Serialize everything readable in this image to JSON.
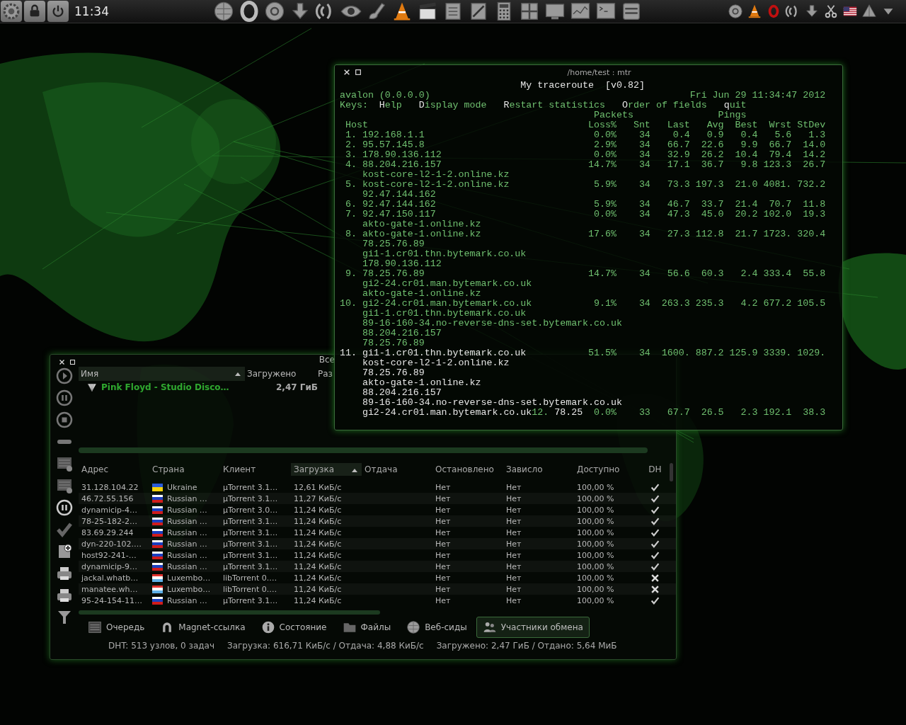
{
  "taskbar": {
    "clock": "11:34"
  },
  "terminal": {
    "title": "/home/test : mtr",
    "heading": "My traceroute  [v0.82]",
    "hostname": "avalon (0.0.0.0)",
    "datetime": "Fri Jun 29 11:34:47 2012",
    "keys_label": "Keys:",
    "keys": [
      "Help",
      "Display mode",
      "Restart statistics",
      "Order of fields",
      "quit"
    ],
    "groups": [
      "Packets",
      "Pings"
    ],
    "columns": [
      "Host",
      "Loss%",
      "Snt",
      "Last",
      "Avg",
      "Best",
      "Wrst",
      "StDev"
    ],
    "hops": [
      {
        "number": "1.",
        "host": "192.168.1.1",
        "stats": [
          "0.0%",
          "34",
          "0.4",
          "0.9",
          "0.4",
          "5.6",
          "1.3"
        ],
        "bright": false,
        "number_bright": false
      },
      {
        "number": "2.",
        "host": "95.57.145.8",
        "stats": [
          "2.9%",
          "34",
          "66.7",
          "22.6",
          "9.9",
          "66.7",
          "14.0"
        ],
        "bright": false,
        "number_bright": false
      },
      {
        "number": "3.",
        "host": "178.90.136.112",
        "stats": [
          "0.0%",
          "34",
          "32.9",
          "26.2",
          "10.4",
          "79.4",
          "14.2"
        ],
        "bright": false,
        "number_bright": false
      },
      {
        "number": "4.",
        "host": "88.204.216.157",
        "stats": [
          "14.7%",
          "34",
          "17.1",
          "36.7",
          "9.8",
          "123.3",
          "26.7"
        ],
        "bright": false,
        "number_bright": false,
        "extras": [
          "kost-core-l2-1-2.online.kz"
        ]
      },
      {
        "number": "5.",
        "host": "kost-core-l2-1-2.online.kz",
        "stats": [
          "5.9%",
          "34",
          "73.3",
          "197.3",
          "21.0",
          "4081.",
          "732.2"
        ],
        "bright": false,
        "number_bright": false,
        "extras": [
          "92.47.144.162"
        ]
      },
      {
        "number": "6.",
        "host": "92.47.144.162",
        "stats": [
          "5.9%",
          "34",
          "46.7",
          "33.7",
          "21.4",
          "70.7",
          "11.8"
        ],
        "bright": false,
        "number_bright": false
      },
      {
        "number": "7.",
        "host": "92.47.150.117",
        "stats": [
          "0.0%",
          "34",
          "47.3",
          "45.0",
          "20.2",
          "102.0",
          "19.3"
        ],
        "bright": false,
        "number_bright": false,
        "extras": [
          "akto-gate-1.online.kz"
        ]
      },
      {
        "number": "8.",
        "host": "akto-gate-1.online.kz",
        "stats": [
          "17.6%",
          "34",
          "27.3",
          "112.8",
          "21.7",
          "1723.",
          "320.4"
        ],
        "bright": false,
        "number_bright": false,
        "extras": [
          "78.25.76.89",
          "gi1-1.cr01.thn.bytemark.co.uk",
          "178.90.136.112"
        ]
      },
      {
        "number": "9.",
        "host": "78.25.76.89",
        "stats": [
          "14.7%",
          "34",
          "56.6",
          "60.3",
          "2.4",
          "333.4",
          "55.8"
        ],
        "bright": false,
        "number_bright": false,
        "extras": [
          "gi2-24.cr01.man.bytemark.co.uk",
          "akto-gate-1.online.kz"
        ]
      },
      {
        "number": "10.",
        "host": "gi2-24.cr01.man.bytemark.co.uk",
        "stats": [
          "9.1%",
          "34",
          "263.3",
          "235.3",
          "4.2",
          "677.2",
          "105.5"
        ],
        "bright": false,
        "number_bright": false,
        "extras": [
          "gi1-1.cr01.thn.bytemark.co.uk",
          "89-16-160-34.no-reverse-dns-set.bytemark.co.uk",
          "88.204.216.157",
          "78.25.76.89"
        ]
      },
      {
        "number": "11.",
        "host": "gi1-1.cr01.thn.bytemark.co.uk",
        "stats": [
          "51.5%",
          "34",
          "1600.",
          "887.2",
          "125.9",
          "3339.",
          "1029."
        ],
        "bright": true,
        "number_bright": true,
        "extras": [
          "kost-core-l2-1-2.online.kz",
          "78.25.76.89",
          "akto-gate-1.online.kz",
          "88.204.216.157",
          "89-16-160-34.no-reverse-dns-set.bytemark.co.uk",
          "gi2-24.cr01.man.bytemark.co.uk"
        ]
      },
      {
        "number": "12.",
        "host": "78.25",
        "stats": [
          "0.0%",
          "33",
          "67.7",
          "26.5",
          "2.3",
          "192.1",
          "38.3"
        ],
        "bright": true,
        "number_bright": false,
        "joined": true
      }
    ]
  },
  "torrent": {
    "title": "Все",
    "list_columns": [
      {
        "label": "Имя",
        "sorted": true
      },
      {
        "label": "Загружено",
        "sorted": false
      },
      {
        "label": "Раз",
        "sorted": false
      }
    ],
    "torrents": [
      {
        "name": "Pink Floyd - Studio Disco…",
        "downloaded": "2,47 ГиБ"
      }
    ],
    "peer_columns": [
      {
        "label": "Адрес",
        "sorted": false
      },
      {
        "label": "Страна",
        "sorted": false
      },
      {
        "label": "Клиент",
        "sorted": false
      },
      {
        "label": "Загрузка",
        "sorted": true
      },
      {
        "label": "Отдача",
        "sorted": false
      },
      {
        "label": "Остановлено",
        "sorted": false
      },
      {
        "label": "Зависло",
        "sorted": false
      },
      {
        "label": "Доступно",
        "sorted": false
      },
      {
        "label": "DH",
        "sorted": false
      }
    ],
    "peers": [
      {
        "address": "31.128.104.22",
        "kind": "ukraine",
        "country": "Ukraine",
        "client": "µTorrent 3.1…",
        "download": "12,61 КиБ/с",
        "stopped": "Нет",
        "stalled": "Нет",
        "available": "100,00 %",
        "checked": true
      },
      {
        "address": "46.72.55.156",
        "kind": "russia",
        "country": "Russian …",
        "client": "µTorrent 3.1…",
        "download": "11,27 КиБ/с",
        "stopped": "Нет",
        "stalled": "Нет",
        "available": "100,00 %",
        "checked": true
      },
      {
        "address": "dynamicip-4…",
        "kind": "russia",
        "country": "Russian …",
        "client": "µTorrent 3.0…",
        "download": "11,24 КиБ/с",
        "stopped": "Нет",
        "stalled": "Нет",
        "available": "100,00 %",
        "checked": true
      },
      {
        "address": "78-25-182-2…",
        "kind": "russia",
        "country": "Russian …",
        "client": "µTorrent 3.1…",
        "download": "11,24 КиБ/с",
        "stopped": "Нет",
        "stalled": "Нет",
        "available": "100,00 %",
        "checked": true
      },
      {
        "address": "83.69.29.244",
        "kind": "russia",
        "country": "Russian …",
        "client": "µTorrent 3.1…",
        "download": "11,24 КиБ/с",
        "stopped": "Нет",
        "stalled": "Нет",
        "available": "100,00 %",
        "checked": true
      },
      {
        "address": "dyn-220-102.…",
        "kind": "russia",
        "country": "Russian …",
        "client": "µTorrent 3.1…",
        "download": "11,24 КиБ/с",
        "stopped": "Нет",
        "stalled": "Нет",
        "available": "100,00 %",
        "checked": true
      },
      {
        "address": "host92-241-…",
        "kind": "russia",
        "country": "Russian …",
        "client": "µTorrent 3.1…",
        "download": "11,24 КиБ/с",
        "stopped": "Нет",
        "stalled": "Нет",
        "available": "100,00 %",
        "checked": true
      },
      {
        "address": "dynamicip-9…",
        "kind": "russia",
        "country": "Russian …",
        "client": "µTorrent 3.1…",
        "download": "11,24 КиБ/с",
        "stopped": "Нет",
        "stalled": "Нет",
        "available": "100,00 %",
        "checked": true
      },
      {
        "address": "jackal.whatb…",
        "kind": "luxembourg",
        "country": "Luxembo…",
        "client": "libTorrent 0.…",
        "download": "11,24 КиБ/с",
        "stopped": "Нет",
        "stalled": "Нет",
        "available": "100,00 %",
        "checked": false
      },
      {
        "address": "manatee.wh…",
        "kind": "luxembourg",
        "country": "Luxembo…",
        "client": "libTorrent 0.…",
        "download": "11,24 КиБ/с",
        "stopped": "Нет",
        "stalled": "Нет",
        "available": "100,00 %",
        "checked": false
      },
      {
        "address": "95-24-154-11…",
        "kind": "russia",
        "country": "Russian …",
        "client": "µTorrent 3.1…",
        "download": "11,24 КиБ/с",
        "stopped": "Нет",
        "stalled": "Нет",
        "available": "100,00 %",
        "checked": true
      }
    ],
    "tabs": [
      {
        "label": "Очередь",
        "kind": "queue",
        "selected": false
      },
      {
        "label": "Magnet-ссылка",
        "kind": "magnet",
        "selected": false
      },
      {
        "label": "Состояние",
        "kind": "info",
        "selected": false
      },
      {
        "label": "Файлы",
        "kind": "folder",
        "selected": false
      },
      {
        "label": "Веб-сиды",
        "kind": "globe",
        "selected": false
      },
      {
        "label": "Участники обмена",
        "kind": "people",
        "selected": true
      }
    ],
    "status_bar": [
      "DHT: 513 узлов, 0 задач",
      "Загрузка: 616,71 КиБ/с / Отдача: 4,88 КиБ/с",
      "Загружено: 2,47 ГиБ / Отдано: 5,64 МиБ"
    ]
  }
}
